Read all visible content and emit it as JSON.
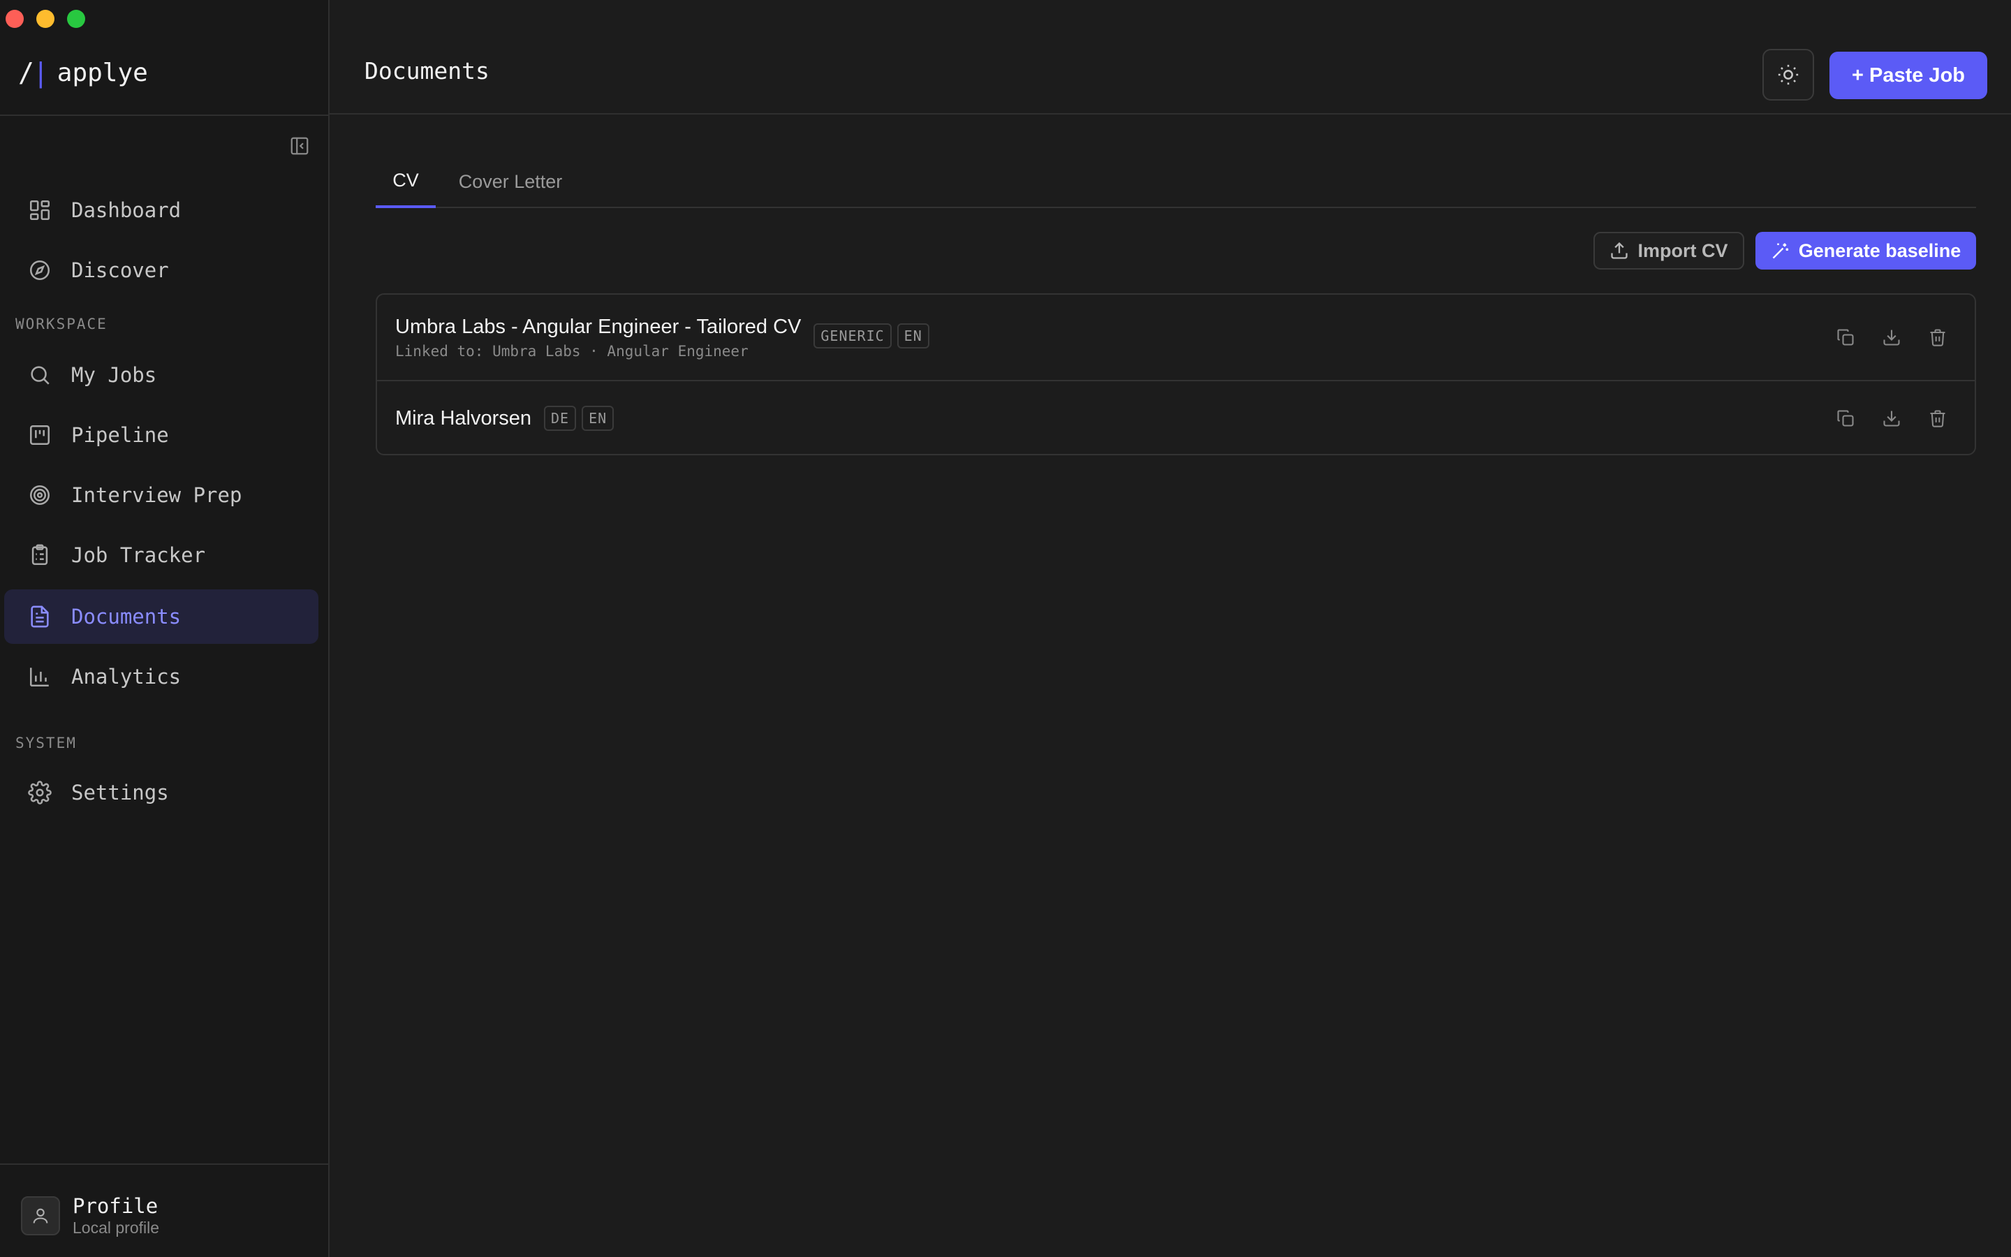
{
  "brand": {
    "mark": "/",
    "name": "applye"
  },
  "nav": {
    "dashboard": "Dashboard",
    "discover": "Discover",
    "workspace_label": "WORKSPACE",
    "my_jobs": "My Jobs",
    "pipeline": "Pipeline",
    "interview_prep": "Interview Prep",
    "job_tracker": "Job Tracker",
    "documents": "Documents",
    "analytics": "Analytics",
    "system_label": "SYSTEM",
    "settings": "Settings"
  },
  "profile": {
    "name": "Profile",
    "sub": "Local profile"
  },
  "header": {
    "title": "Documents",
    "paste_job": "+ Paste Job"
  },
  "tabs": {
    "cv": "CV",
    "cover_letter": "Cover Letter"
  },
  "actions": {
    "import_cv": "Import CV",
    "generate_baseline": "Generate baseline"
  },
  "documents": [
    {
      "title": "Umbra Labs - Angular Engineer - Tailored CV",
      "linked": "Linked to: Umbra Labs · Angular Engineer",
      "badges": [
        "GENERIC",
        "EN"
      ]
    },
    {
      "title": "Mira Halvorsen",
      "badges": [
        "DE",
        "EN"
      ]
    }
  ],
  "colors": {
    "accent": "#5b5bf6",
    "background": "#1c1c1c",
    "sidebar": "#181818"
  }
}
